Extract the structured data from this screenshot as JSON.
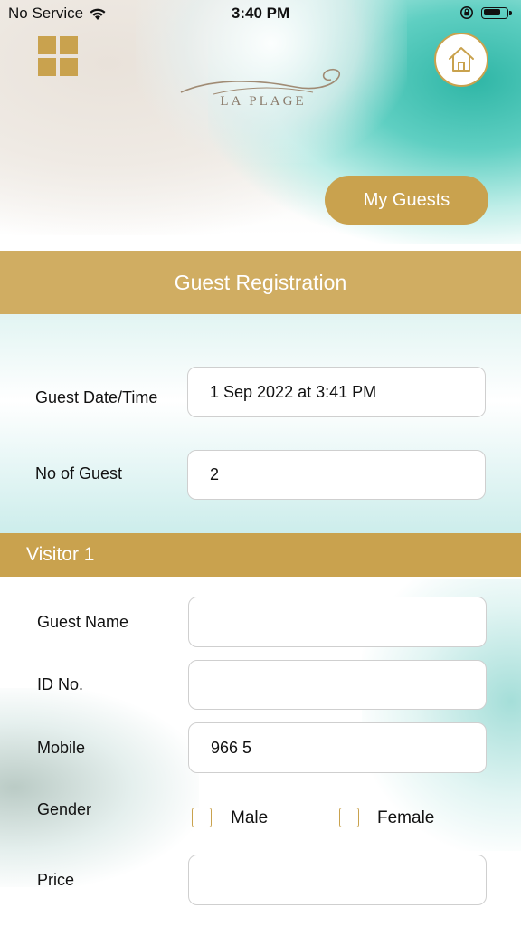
{
  "status_bar": {
    "carrier": "No Service",
    "time": "3:40 PM",
    "battery_level": 0.75,
    "wifi_icon": "wifi-icon",
    "rotation_lock_icon": "rotation-lock-icon"
  },
  "header": {
    "menu_icon": "grid-menu-icon",
    "home_icon": "home-icon",
    "logo_text": "LA PLAGE",
    "my_guests_label": "My Guests"
  },
  "title": "Guest Registration",
  "form": {
    "date_label": "Guest Date/Time",
    "date_value": "1 Sep 2022 at 3:41 PM",
    "count_label": "No of Guest",
    "count_value": "2"
  },
  "visitor": {
    "heading": "Visitor 1",
    "name_label": "Guest Name",
    "name_value": "",
    "id_label": "ID No.",
    "id_value": "",
    "mobile_label": "Mobile",
    "mobile_value": "966 5",
    "gender_label": "Gender",
    "gender_male": "Male",
    "gender_female": "Female",
    "price_label": "Price",
    "price_value": ""
  },
  "colors": {
    "accent": "#c9a24e",
    "banner": "#d0ad62",
    "field_border": "#cfcfcf"
  }
}
